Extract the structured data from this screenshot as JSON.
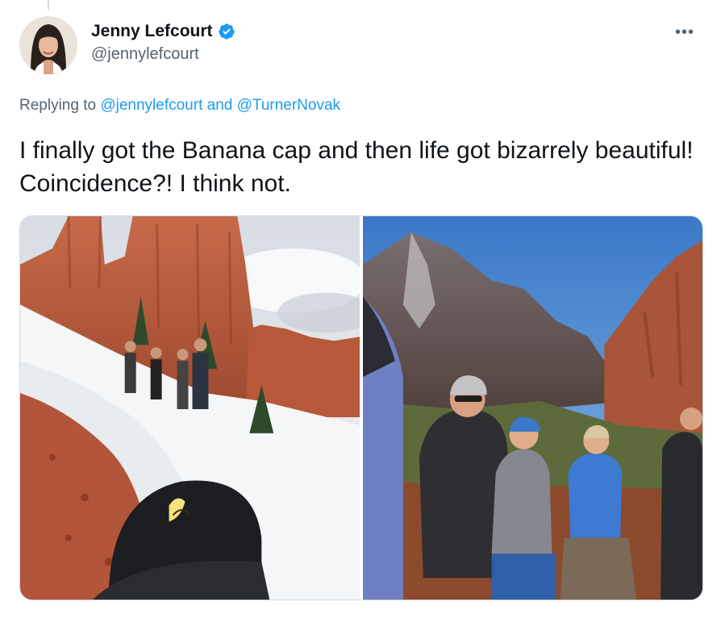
{
  "tweet": {
    "author": {
      "display_name": "Jenny Lefcourt",
      "handle": "@jennylefcourt",
      "verified": true,
      "avatar_icon": "profile-photo"
    },
    "replying_prefix": "Replying to",
    "replying_users": [
      "@jennylefcourt",
      "@TurnerNovak"
    ],
    "replying_joiner": "and",
    "text": "I finally got the Banana cap and then life got bizarrely beautiful! Coincidence?! I think not.",
    "more_icon": "•••",
    "media": [
      {
        "type": "photo",
        "subject": "snowy hoodoo trail with banana cap"
      },
      {
        "type": "photo",
        "subject": "hikers at canyon overlook"
      }
    ]
  },
  "colors": {
    "text": "#0f1419",
    "secondary": "#536471",
    "link": "#1d9bf0",
    "verified": "#1d9bf0",
    "border": "#cfd9de"
  }
}
